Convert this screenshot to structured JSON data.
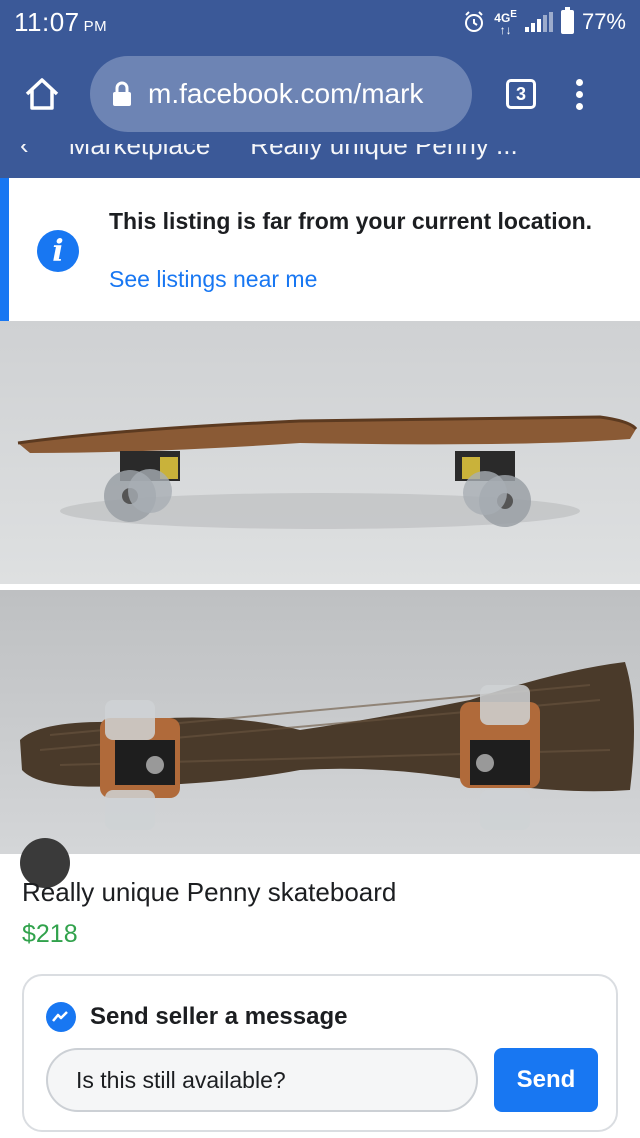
{
  "status_bar": {
    "time": "11:07",
    "meridiem": "PM",
    "network": "4G",
    "network_sub": "E",
    "battery": "77%"
  },
  "browser": {
    "url": "m.facebook.com/mark",
    "tab_count": "3"
  },
  "breadcrumb": {
    "section": "Marketplace",
    "item": "Really unique Penny ..."
  },
  "notice": {
    "title": "This listing is far from your current location.",
    "link": "See listings near me"
  },
  "listing": {
    "title": "Really unique Penny skateboard",
    "price": "$218"
  },
  "message": {
    "header": "Send seller a message",
    "input_value": "Is this still available?",
    "send_label": "Send"
  },
  "colors": {
    "facebook_blue": "#3b5998",
    "link_blue": "#1877f2",
    "price_green": "#31a24c"
  }
}
